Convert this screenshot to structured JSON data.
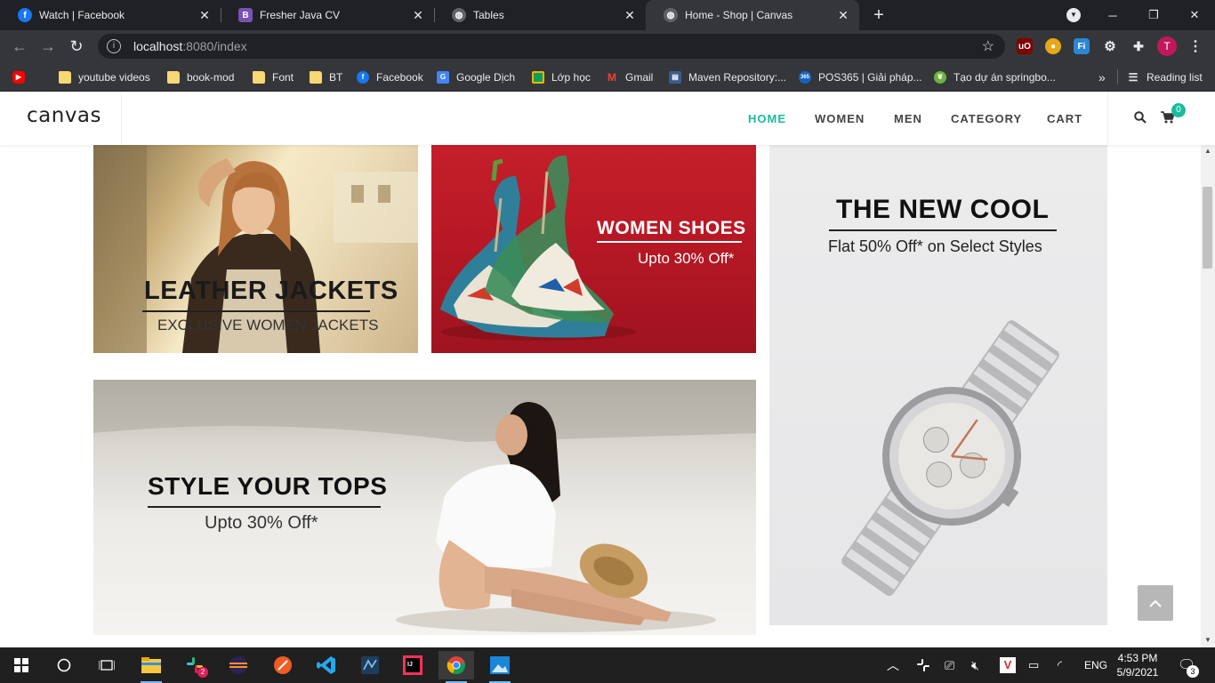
{
  "browser": {
    "tabs": [
      {
        "title": "Watch | Facebook",
        "icon": "facebook-icon",
        "active": false
      },
      {
        "title": "Fresher Java CV",
        "icon": "bootstrap-icon",
        "active": false
      },
      {
        "title": "Tables",
        "icon": "globe-icon",
        "active": false
      },
      {
        "title": "Home - Shop | Canvas",
        "icon": "globe-icon",
        "active": true
      }
    ],
    "url_host": "localhost",
    "url_rest": ":8080/index",
    "profile_initial": "T",
    "bookmarks": [
      {
        "label": "",
        "icon": "youtube-icon"
      },
      {
        "label": "youtube videos",
        "icon": "folder-icon"
      },
      {
        "label": "book-mod",
        "icon": "folder-icon"
      },
      {
        "label": "Font",
        "icon": "folder-icon"
      },
      {
        "label": "BT",
        "icon": "folder-icon"
      },
      {
        "label": "Facebook",
        "icon": "facebook-icon"
      },
      {
        "label": "Google Dịch",
        "icon": "google-translate-icon"
      },
      {
        "label": "Lớp học",
        "icon": "classroom-icon"
      },
      {
        "label": "Gmail",
        "icon": "gmail-icon"
      },
      {
        "label": "Maven Repository:...",
        "icon": "maven-icon"
      },
      {
        "label": "POS365 | Giải pháp...",
        "icon": "pos365-icon"
      },
      {
        "label": "Tạo dự án springbo...",
        "icon": "spring-icon"
      }
    ],
    "bookmarks_overflow": "»",
    "reading_list": "Reading list"
  },
  "site": {
    "logo": "canvas",
    "menu": [
      {
        "label": "HOME",
        "active": true
      },
      {
        "label": "WOMEN",
        "active": false
      },
      {
        "label": "MEN",
        "active": false
      },
      {
        "label": "CATEGORY",
        "active": false
      },
      {
        "label": "CART",
        "active": false
      }
    ],
    "cart_count": "0"
  },
  "banners": {
    "jacket": {
      "title": "LEATHER JACKETS",
      "subtitle": "EXCLUSIVE WOMEN JACKETS"
    },
    "shoes": {
      "title": "WOMEN SHOES",
      "subtitle": "Upto 30% Off*"
    },
    "tops": {
      "title": "STYLE YOUR TOPS",
      "subtitle": "Upto 30% Off*"
    },
    "watch": {
      "title": "THE NEW COOL",
      "subtitle": "Flat 50% Off* on Select Styles"
    }
  },
  "taskbar": {
    "slack_badge": "2",
    "language": "ENG",
    "time": "4:53 PM",
    "date": "5/9/2021",
    "notifications": "3"
  },
  "colors": {
    "accent": "#1abc9c",
    "chrome_dark": "#202124",
    "chrome_toolbar": "#35363a"
  }
}
